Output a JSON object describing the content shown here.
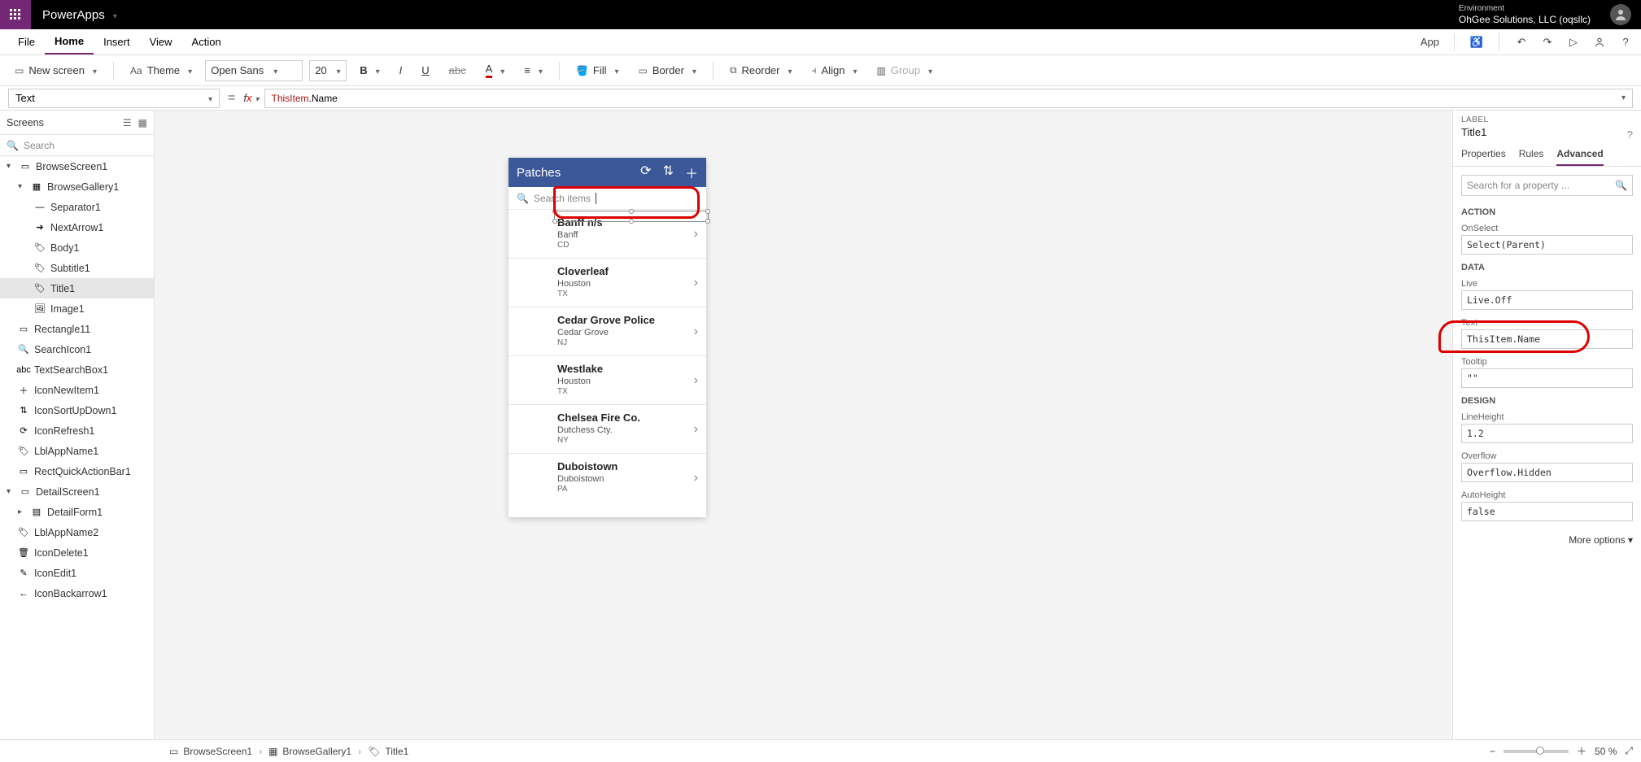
{
  "topbar": {
    "app": "PowerApps",
    "envLabel": "Environment",
    "envName": "OhGee Solutions, LLC (oqsllc)"
  },
  "menu": {
    "file": "File",
    "home": "Home",
    "insert": "Insert",
    "view": "View",
    "action": "Action",
    "app": "App"
  },
  "toolbar": {
    "newScreen": "New screen",
    "theme": "Theme",
    "font": "Open Sans",
    "size": "20",
    "fill": "Fill",
    "border": "Border",
    "reorder": "Reorder",
    "align": "Align",
    "group": "Group"
  },
  "formula": {
    "prop": "Text",
    "token1": "ThisItem",
    "token2": ".Name"
  },
  "left": {
    "title": "Screens",
    "search": "Search",
    "nodes": {
      "browseScreen": "BrowseScreen1",
      "browseGallery": "BrowseGallery1",
      "separator": "Separator1",
      "nextArrow": "NextArrow1",
      "body": "Body1",
      "subtitle": "Subtitle1",
      "title": "Title1",
      "image": "Image1",
      "rectangle": "Rectangle11",
      "searchIcon": "SearchIcon1",
      "textSearch": "TextSearchBox1",
      "iconNew": "IconNewItem1",
      "iconSort": "IconSortUpDown1",
      "iconRefresh": "IconRefresh1",
      "lblApp": "LblAppName1",
      "rectQuick": "RectQuickActionBar1",
      "detailScreen": "DetailScreen1",
      "detailForm": "DetailForm1",
      "lblApp2": "LblAppName2",
      "iconDelete": "IconDelete1",
      "iconEdit": "IconEdit1",
      "iconBack": "IconBackarrow1"
    }
  },
  "phone": {
    "title": "Patches",
    "searchPlaceholder": "Search items",
    "items": [
      {
        "name": "Banff   n/s",
        "sub": "Banff",
        "st": "CD"
      },
      {
        "name": "Cloverleaf",
        "sub": "Houston",
        "st": "TX"
      },
      {
        "name": "Cedar Grove Police",
        "sub": "Cedar Grove",
        "st": "NJ"
      },
      {
        "name": "Westlake",
        "sub": "Houston",
        "st": "TX"
      },
      {
        "name": "Chelsea Fire Co.",
        "sub": "Dutchess Cty.",
        "st": "NY"
      },
      {
        "name": "Duboistown",
        "sub": "Duboistown",
        "st": "PA"
      }
    ]
  },
  "right": {
    "labelHdr": "LABEL",
    "title": "Title1",
    "tabs": {
      "props": "Properties",
      "rules": "Rules",
      "adv": "Advanced"
    },
    "searchPh": "Search for a property ...",
    "sec": {
      "action": "ACTION",
      "data": "DATA",
      "design": "DESIGN"
    },
    "onSelect": {
      "lbl": "OnSelect",
      "val": "Select(Parent)"
    },
    "live": {
      "lbl": "Live",
      "val": "Live.Off"
    },
    "text": {
      "lbl": "Text",
      "val": "ThisItem.Name"
    },
    "tooltip": {
      "lbl": "Tooltip",
      "val": "\"\""
    },
    "lineHeight": {
      "lbl": "LineHeight",
      "val": "1.2"
    },
    "overflow": {
      "lbl": "Overflow",
      "val": "Overflow.Hidden"
    },
    "autoHeight": {
      "lbl": "AutoHeight",
      "val": "false"
    },
    "more": "More options"
  },
  "bottom": {
    "crumbs": {
      "s": "BrowseScreen1",
      "g": "BrowseGallery1",
      "t": "Title1"
    },
    "zoom": "50 %"
  }
}
